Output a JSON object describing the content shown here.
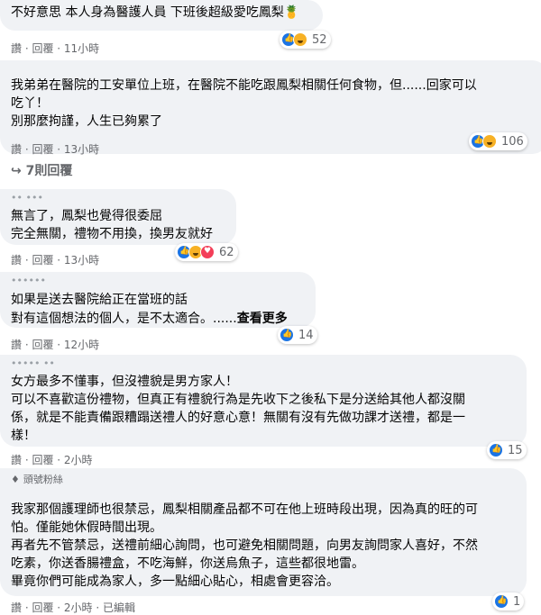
{
  "comments": [
    {
      "text": "不好意思 本人身為醫護人員 下班後超級愛吃鳳梨🍍",
      "actions": "讚 · 回覆 · 11小時",
      "reaction_count": "52"
    },
    {
      "text": "我弟弟在醫院的工安單位上班，在醫院不能吃跟鳳梨相關任何食物，但......回家可以\n吃丫！\n別那麼拘謹，人生已夠累了",
      "actions": "讚 · 回覆 · 13小時",
      "reaction_count": "106",
      "replies_label": "7則回覆"
    },
    {
      "text": "無言了，鳳梨也覺得很委屈\n完全無關，禮物不用換，換男友就好",
      "actions": "讚 · 回覆 · 13小時",
      "reaction_count": "62"
    },
    {
      "text": "如果是送去醫院給正在當班的話\n對有這個想法的個人，是不太適合。......",
      "see_more": "查看更多",
      "actions": "讚 · 回覆 · 12小時",
      "reaction_count": "14"
    },
    {
      "text": "女方最多不懂事，但沒禮貌是男方家人！\n可以不喜歡這份禮物，但真正有禮貌行為是先收下之後私下是分送給其他人都沒關\n係，就是不能責備跟糟蹋送禮人的好意心意！無關有沒有先做功課才送禮，都是一\n樣！",
      "actions": "讚 · 回覆 · 2小時",
      "reaction_count": "15"
    },
    {
      "badge": "頭號粉絲",
      "text": "我家那個護理師也很禁忌，鳳梨相關產品都不可在他上班時段出現，因為真的旺的可\n怕。僅能她休假時間出現。\n再者先不管禁忌，送禮前細心詢問，也可避免相關問題，向男友詢問家人喜好，不然\n吃素，你送香腸禮盒，不吃海鮮，你送烏魚子，這些都很地雷。\n畢竟你們可能成為家人，多一點細心貼心，相處會更容洽。",
      "actions": "讚 · 回覆 · 2小時 · 已編輯",
      "reaction_count": "1"
    }
  ]
}
